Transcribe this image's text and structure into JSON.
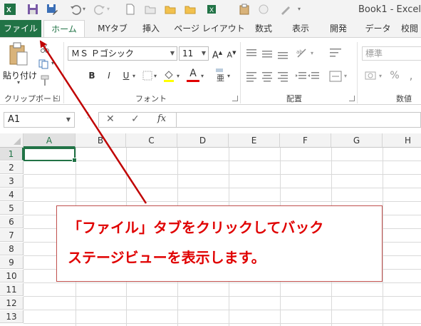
{
  "window": {
    "title": "Book1 - Excel"
  },
  "tabs": [
    "ファイル",
    "ホーム",
    "MYタブ",
    "挿入",
    "ページ レイアウト",
    "数式",
    "表示",
    "開発",
    "データ",
    "校閲"
  ],
  "ribbon": {
    "paste_label": "貼り付け",
    "clipboard_label": "クリップボード",
    "font_name": "ＭＳ Ｐゴシック",
    "font_size": "11",
    "font_group_label": "フォント",
    "bold": "B",
    "italic": "I",
    "underline": "U",
    "align_group_label": "配置",
    "number_format": "標準",
    "percent": "%",
    "comma": ",",
    "number_group_label": "数値"
  },
  "formula_bar": {
    "name_box": "A1",
    "cancel": "✕",
    "enter": "✓",
    "fx": "fx",
    "formula": ""
  },
  "sheet": {
    "columns": [
      "A",
      "B",
      "C",
      "D",
      "E",
      "F",
      "G",
      "H"
    ],
    "rows": [
      "1",
      "2",
      "3",
      "4",
      "5",
      "6",
      "7",
      "8",
      "9",
      "10",
      "11",
      "12",
      "13"
    ],
    "selected_cell": "A1"
  },
  "annotation": {
    "line1": "「ファイル」タブをクリックしてバック",
    "line2": "ステージビューを表示します。"
  },
  "colors": {
    "excel_green": "#217346",
    "arrow_red": "#c00000",
    "annotation_text": "#e00000",
    "annotation_border": "#c0504d"
  }
}
